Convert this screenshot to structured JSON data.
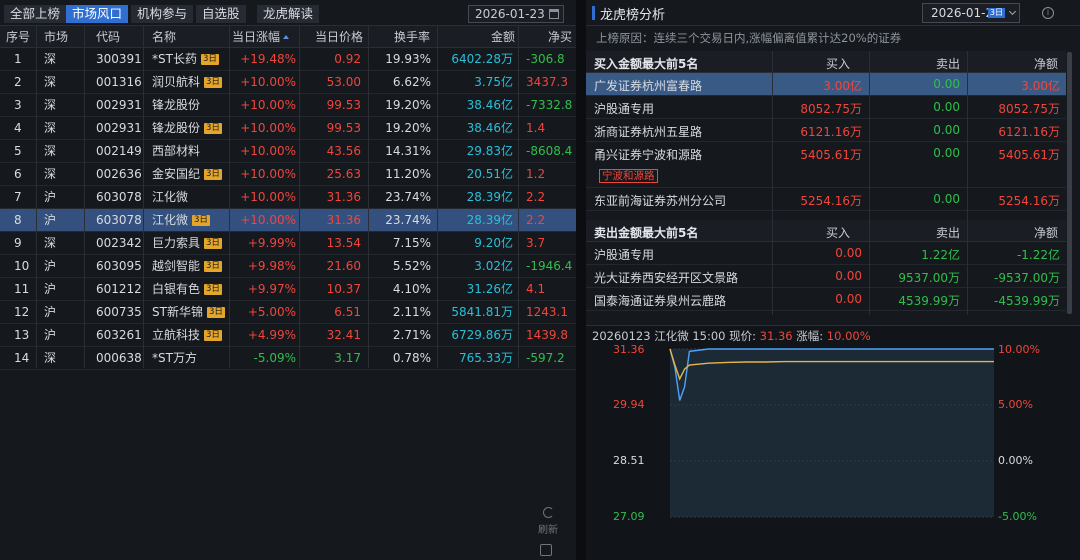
{
  "tabs": [
    "全部上榜",
    "市场风口",
    "机构参与",
    "自选股",
    "龙虎解读"
  ],
  "date": "2026-01-23",
  "columns": [
    "序号",
    "市场",
    "代码",
    "名称",
    "当日涨幅",
    "当日价格",
    "换手率",
    "金额",
    "净买"
  ],
  "rows": [
    {
      "idx": "1",
      "mkt": "深",
      "code": "300391",
      "name": "*ST长药",
      "badge": "3日",
      "chg": "+19.48%",
      "price": "0.92",
      "turn": "19.93%",
      "amt": "6402.28万",
      "net": "-306.8"
    },
    {
      "idx": "2",
      "mkt": "深",
      "code": "001316",
      "name": "润贝航科",
      "badge": "3日",
      "chg": "+10.00%",
      "price": "53.00",
      "turn": "6.62%",
      "amt": "3.75亿",
      "net": "3437.3"
    },
    {
      "idx": "3",
      "mkt": "深",
      "code": "002931",
      "name": "锋龙股份",
      "badge": "",
      "chg": "+10.00%",
      "price": "99.53",
      "turn": "19.20%",
      "amt": "38.46亿",
      "net": "-7332.8"
    },
    {
      "idx": "4",
      "mkt": "深",
      "code": "002931",
      "name": "锋龙股份",
      "badge": "3日",
      "chg": "+10.00%",
      "price": "99.53",
      "turn": "19.20%",
      "amt": "38.46亿",
      "net": "1.4"
    },
    {
      "idx": "5",
      "mkt": "深",
      "code": "002149",
      "name": "西部材料",
      "badge": "",
      "chg": "+10.00%",
      "price": "43.56",
      "turn": "14.31%",
      "amt": "29.83亿",
      "net": "-8608.4"
    },
    {
      "idx": "6",
      "mkt": "深",
      "code": "002636",
      "name": "金安国纪",
      "badge": "3日",
      "chg": "+10.00%",
      "price": "25.63",
      "turn": "11.20%",
      "amt": "20.51亿",
      "net": "1.2"
    },
    {
      "idx": "7",
      "mkt": "沪",
      "code": "603078",
      "name": "江化微",
      "badge": "",
      "chg": "+10.00%",
      "price": "31.36",
      "turn": "23.74%",
      "amt": "28.39亿",
      "net": "2.2"
    },
    {
      "idx": "8",
      "mkt": "沪",
      "code": "603078",
      "name": "江化微",
      "badge": "3日",
      "chg": "+10.00%",
      "price": "31.36",
      "turn": "23.74%",
      "amt": "28.39亿",
      "net": "2.2"
    },
    {
      "idx": "9",
      "mkt": "深",
      "code": "002342",
      "name": "巨力索具",
      "badge": "3日",
      "chg": "+9.99%",
      "price": "13.54",
      "turn": "7.15%",
      "amt": "9.20亿",
      "net": "3.7"
    },
    {
      "idx": "10",
      "mkt": "沪",
      "code": "603095",
      "name": "越剑智能",
      "badge": "3日",
      "chg": "+9.98%",
      "price": "21.60",
      "turn": "5.52%",
      "amt": "3.02亿",
      "net": "-1946.4"
    },
    {
      "idx": "11",
      "mkt": "沪",
      "code": "601212",
      "name": "白银有色",
      "badge": "3日",
      "chg": "+9.97%",
      "price": "10.37",
      "turn": "4.10%",
      "amt": "31.26亿",
      "net": "4.1"
    },
    {
      "idx": "12",
      "mkt": "沪",
      "code": "600735",
      "name": "ST新华锦",
      "badge": "3日",
      "chg": "+5.00%",
      "price": "6.51",
      "turn": "2.11%",
      "amt": "5841.81万",
      "net": "1243.1"
    },
    {
      "idx": "13",
      "mkt": "沪",
      "code": "603261",
      "name": "立航科技",
      "badge": "3日",
      "chg": "+4.99%",
      "price": "32.41",
      "turn": "2.71%",
      "amt": "6729.86万",
      "net": "1439.8"
    },
    {
      "idx": "14",
      "mkt": "深",
      "code": "000638",
      "name": "*ST万方",
      "badge": "",
      "chg": "-5.09%",
      "price": "3.17",
      "turn": "0.78%",
      "amt": "765.33万",
      "net": "-597.2"
    }
  ],
  "selected_row_index": 7,
  "refresh_label": "刷新",
  "analysis": {
    "title": "龙虎榜分析",
    "date": "2026-01-23",
    "date_badge": "3日",
    "reason": "上榜原因：连续三个交易日内,涨幅偏离值累计达20%的证券",
    "buy_header": "买入金额最大前5名",
    "sell_header": "卖出金额最大前5名",
    "col_buy": "买入",
    "col_sell": "卖出",
    "col_net": "净额",
    "buy_rows": [
      {
        "name": "广发证券杭州富春路",
        "buy": "3.00亿",
        "sell": "0.00",
        "net": "3.00亿"
      },
      {
        "name": "沪股通专用",
        "buy": "8052.75万",
        "sell": "0.00",
        "net": "8052.75万"
      },
      {
        "name": "浙商证券杭州五星路",
        "buy": "6121.16万",
        "sell": "0.00",
        "net": "6121.16万"
      },
      {
        "name": "甬兴证券宁波和源路",
        "buy": "5405.61万",
        "sell": "0.00",
        "net": "5405.61万"
      },
      {
        "name": "东亚前海证券苏州分公司",
        "buy": "5254.16万",
        "sell": "0.00",
        "net": "5254.16万"
      }
    ],
    "buy_tag": "宁波和源路",
    "sell_rows": [
      {
        "name": "沪股通专用",
        "buy": "0.00",
        "sell": "1.22亿",
        "net": "-1.22亿"
      },
      {
        "name": "光大证券西安经开区文景路",
        "buy": "0.00",
        "sell": "9537.00万",
        "net": "-9537.00万"
      },
      {
        "name": "国泰海通证券泉州云鹿路",
        "buy": "0.00",
        "sell": "4539.99万",
        "net": "-4539.99万"
      }
    ]
  },
  "chart": {
    "head_prefix": "20260123 江化微 15:00 现价:",
    "price": "31.36",
    "chg_label": "涨幅:",
    "chg": "10.00%",
    "y_left": [
      "31.36",
      "29.94",
      "28.51",
      "27.09"
    ],
    "y_right": [
      "10.00%",
      "5.00%",
      "0.00%",
      "-5.00%"
    ]
  },
  "chart_data": {
    "type": "line",
    "title": "",
    "ylim": [
      27.09,
      31.36
    ],
    "series": [
      {
        "name": "",
        "color": "#4fa3f7",
        "values": [
          31.36,
          30.9,
          30.05,
          30.4,
          31.3,
          31.36,
          31.36,
          31.36,
          31.36,
          31.36,
          31.36,
          31.36,
          31.36,
          31.36,
          31.36,
          31.36,
          31.36,
          31.36,
          31.36,
          31.36,
          31.36
        ]
      },
      {
        "name": "",
        "color": "#e8b44a",
        "values": [
          31.36,
          30.95,
          30.6,
          30.85,
          30.95,
          31.0,
          31.02,
          31.03,
          31.03,
          31.04,
          31.04,
          31.04,
          31.04,
          31.04,
          31.04,
          31.04,
          31.04,
          31.04,
          31.04,
          31.04,
          31.04
        ]
      }
    ]
  }
}
